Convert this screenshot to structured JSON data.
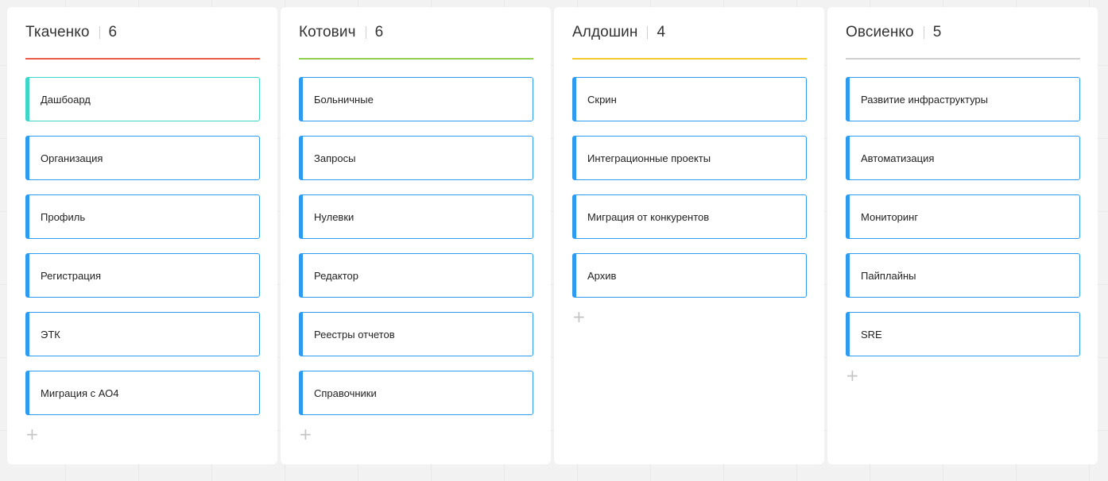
{
  "columns": [
    {
      "title": "Ткаченко",
      "count": "6",
      "accent": "#ea5a47",
      "cards": [
        "Дашбоард",
        "Организация",
        "Профиль",
        "Регистрация",
        "ЭТК",
        "Миграция с АО4"
      ],
      "highlighted_card_color": "#3fd6c9"
    },
    {
      "title": "Котович",
      "count": "6",
      "accent": "#8fd14f",
      "cards": [
        "Больничные",
        "Запросы",
        "Нулевки",
        "Редактор",
        "Реестры отчетов",
        "Справочники"
      ]
    },
    {
      "title": "Алдошин",
      "count": "4",
      "accent": "#f5c82b",
      "cards": [
        "Скрин",
        "Интеграционные проекты",
        "Миграция от конкурентов",
        "Архив"
      ]
    },
    {
      "title": "Овсиенко",
      "count": "5",
      "accent": "#d0d0d0",
      "cards": [
        "Развитие инфраструктуры",
        "Автоматизация",
        "Мониторинг",
        "Пайплайны",
        "SRE"
      ]
    }
  ],
  "card_color": "#2d9cf0",
  "add_icon": "plus-icon",
  "add_symbol": "+"
}
